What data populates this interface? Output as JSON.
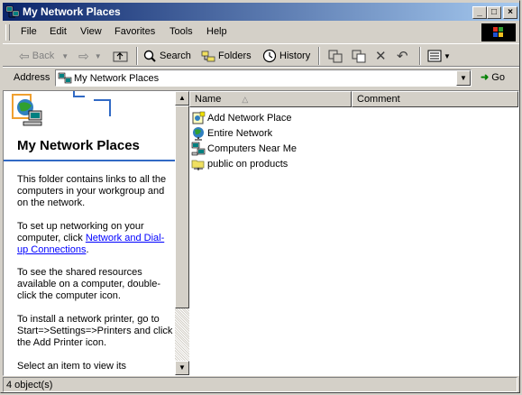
{
  "window": {
    "title": "My Network Places"
  },
  "menubar": {
    "items": [
      "File",
      "Edit",
      "View",
      "Favorites",
      "Tools",
      "Help"
    ]
  },
  "toolbar": {
    "back": "Back",
    "search": "Search",
    "folders": "Folders",
    "history": "History"
  },
  "address": {
    "label": "Address",
    "value": "My Network Places",
    "go": "Go"
  },
  "left_pane": {
    "heading": "My Network Places",
    "p1": "This folder contains links to all the computers in your workgroup and on the network.",
    "p2_before": "To set up networking on your computer, click ",
    "p2_link": "Network and Dial-up Connections",
    "p2_after": ".",
    "p3": "To see the shared resources available on a computer, double-click the computer icon.",
    "p4": "To install a network printer, go to Start=>Settings=>Printers and click the Add Printer icon.",
    "p5": "Select an item to view its"
  },
  "list": {
    "columns": [
      "Name",
      "Comment"
    ],
    "items": [
      {
        "name": "Add Network Place",
        "icon": "add-network-place-icon"
      },
      {
        "name": "Entire Network",
        "icon": "globe-icon"
      },
      {
        "name": "Computers Near Me",
        "icon": "computers-icon"
      },
      {
        "name": "public on products",
        "icon": "shared-folder-icon"
      }
    ]
  },
  "statusbar": {
    "text": "4 object(s)"
  }
}
